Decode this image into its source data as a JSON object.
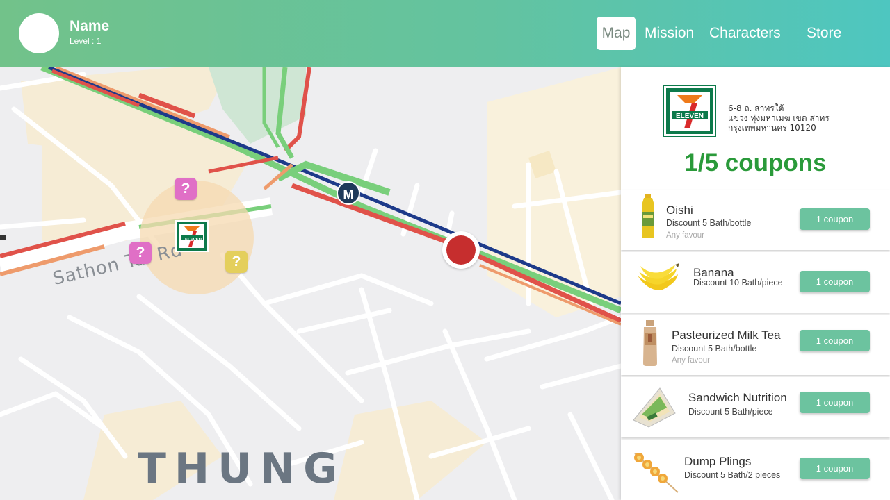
{
  "header": {
    "user_name": "Name",
    "user_level": "Level : 1",
    "tabs": [
      {
        "label": "Map",
        "active": true
      },
      {
        "label": "Mission",
        "active": false
      },
      {
        "label": "Characters",
        "active": false
      },
      {
        "label": "Store",
        "active": false
      }
    ]
  },
  "map": {
    "road_label": "Sathon Tai Rd",
    "area_label": "THUNG",
    "metro_label": "M",
    "mystery_label": "?",
    "store_logo_text": "ELEVEN",
    "colors": {
      "road_red": "#e0524a",
      "road_orange": "#ee9b6c",
      "road_green": "#79cf7b",
      "rail_blue": "#1d3a8a",
      "zone": "#f6d9b0"
    }
  },
  "panel": {
    "logo_text": "ELEVEN",
    "address": [
      "6-8 ถ. สาทรใต้",
      "แขวง ทุ่งมหาเมฆ เขต สาทร",
      "กรุงเทพมหานคร 10120"
    ],
    "coupon_count": "1/5 coupons",
    "items": [
      {
        "title": "Oishi",
        "desc": "Discount 5 Bath/bottle",
        "note": "Any favour",
        "button": "1 coupon",
        "icon": "oishi-bottle-icon"
      },
      {
        "title": "Banana",
        "desc": "Discount 10 Bath/piece",
        "note": "",
        "button": "1 coupon",
        "icon": "banana-icon"
      },
      {
        "title": "Pasteurized Milk Tea",
        "desc": "Discount 5 Bath/bottle",
        "note": "Any favour",
        "button": "1 coupon",
        "icon": "milk-tea-bottle-icon"
      },
      {
        "title": "Sandwich Nutrition",
        "desc": "Discount 5 Bath/piece",
        "note": "",
        "button": "1 coupon",
        "icon": "sandwich-icon"
      },
      {
        "title": "Dump Plings",
        "desc": "Discount 5 Bath/2 pieces",
        "note": "",
        "button": "1 coupon",
        "icon": "dumpling-skewer-icon"
      }
    ],
    "accent": "#6cc39f"
  }
}
